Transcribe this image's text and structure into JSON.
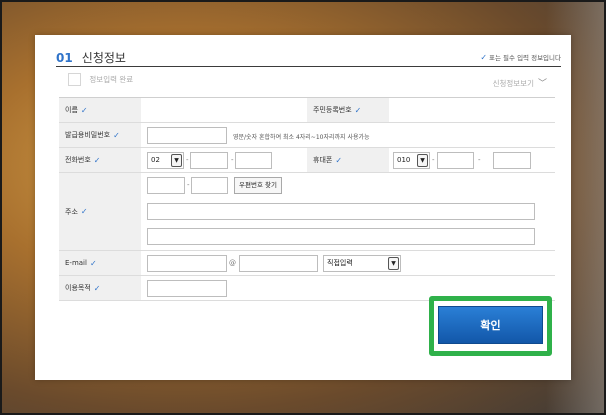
{
  "header": {
    "number": "01",
    "title": "신청정보",
    "required_note": "표는 필수 입력 정보입니다"
  },
  "subbar": {
    "complete_label": "정보입력 완료",
    "view_label": "신청정보보기"
  },
  "rows": {
    "name": {
      "label": "이름"
    },
    "resident_no": {
      "label": "주민등록번호"
    },
    "password": {
      "label": "발급용비밀번호",
      "hint": "영문/숫자 혼합하여 최소 4자리~10자리까지 사용가능"
    },
    "phone": {
      "label": "전화번호",
      "area_code": "02"
    },
    "mobile": {
      "label": "휴대폰",
      "prefix": "010"
    },
    "address": {
      "label": "주소",
      "zip_button": "우편번호 찾기"
    },
    "email": {
      "label": "E-mail",
      "at": "@",
      "domain_select": "직접입력"
    },
    "purpose": {
      "label": "이용목적"
    }
  },
  "confirm_label": "확인",
  "colors": {
    "accent_blue": "#2f73c9",
    "confirm_bg": "#1a68c0",
    "highlight_green": "#2fb14a"
  }
}
